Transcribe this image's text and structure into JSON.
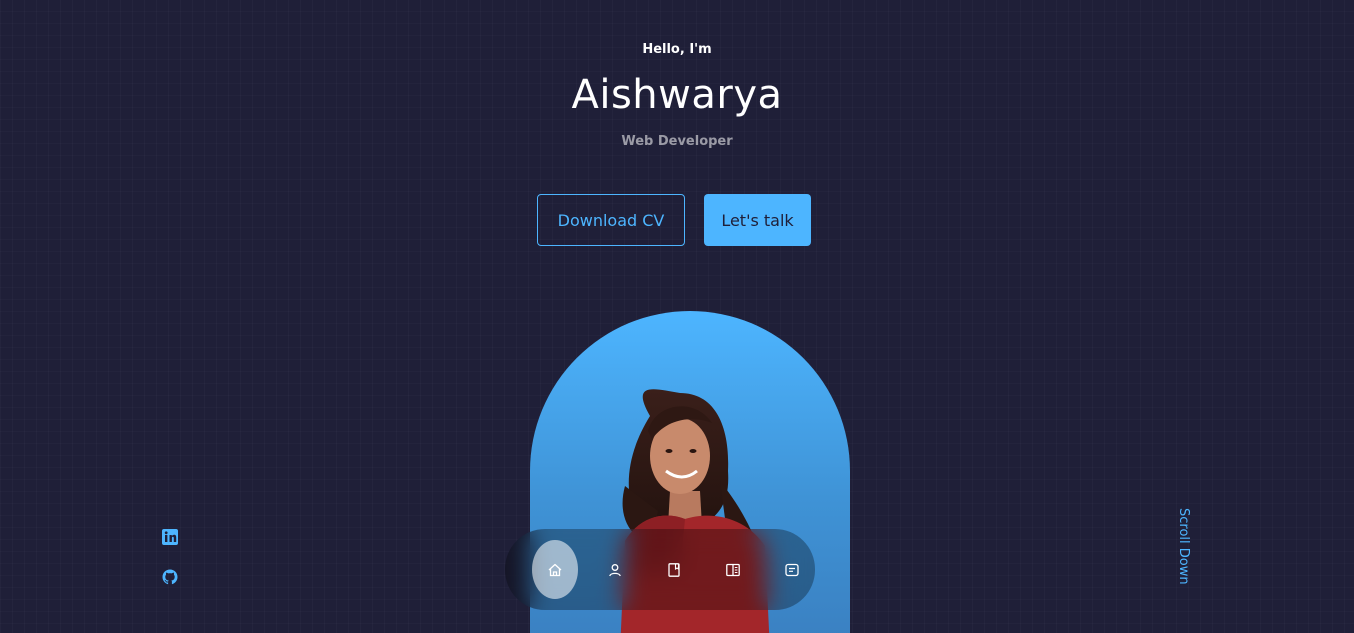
{
  "header": {
    "greeting": "Hello, I'm",
    "name": "Aishwarya",
    "role": "Web Developer"
  },
  "cta": {
    "download_label": "Download CV",
    "talk_label": "Let's talk"
  },
  "scroll": {
    "label": "Scroll Down"
  },
  "socials": [
    {
      "icon": "linkedin-icon"
    },
    {
      "icon": "github-icon"
    }
  ],
  "nav": {
    "items": [
      {
        "icon": "home-icon",
        "active": true
      },
      {
        "icon": "user-icon",
        "active": false
      },
      {
        "icon": "book-icon",
        "active": false
      },
      {
        "icon": "services-icon",
        "active": false
      },
      {
        "icon": "message-icon",
        "active": false
      }
    ]
  },
  "colors": {
    "background": "#1f1f38",
    "accent": "#4db5ff",
    "text": "#ffffff"
  }
}
